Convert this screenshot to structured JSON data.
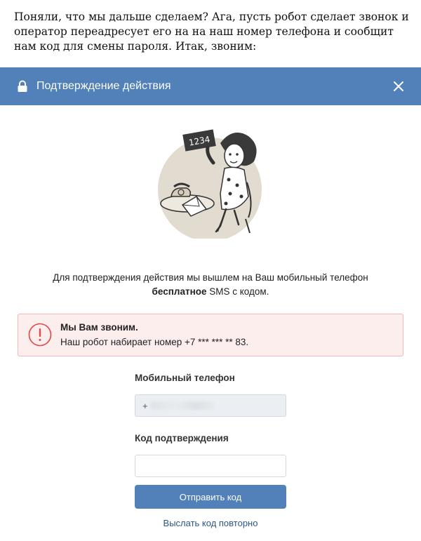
{
  "intro_text": "Поняли, что мы дальше сделаем? Ага, пусть робот сделает звонок и оператор переадресует его на на наш номер телефона и сообщит нам код для смены пароля. Итак, звоним:",
  "header": {
    "title": "Подтверждение действия",
    "icon": "lock-icon",
    "close_icon": "close-icon",
    "color": "#5181b8"
  },
  "illustration": {
    "card_number": "1234"
  },
  "info": {
    "line1": "Для подтверждения действия мы вышлем на Ваш мобильный телефон",
    "bold": "бесплатное",
    "rest": " SMS с кодом."
  },
  "alert": {
    "title": "Мы Вам звоним.",
    "text": "Наш робот набирает номер +7 *** *** ** 83.",
    "icon": "exclamation-icon",
    "color": "#e64646"
  },
  "form": {
    "phone_label": "Мобильный телефон",
    "phone_value": "+",
    "code_label": "Код подтверждения",
    "code_value": "",
    "submit_label": "Отправить код",
    "resend_label": "Выслать код повторно"
  }
}
